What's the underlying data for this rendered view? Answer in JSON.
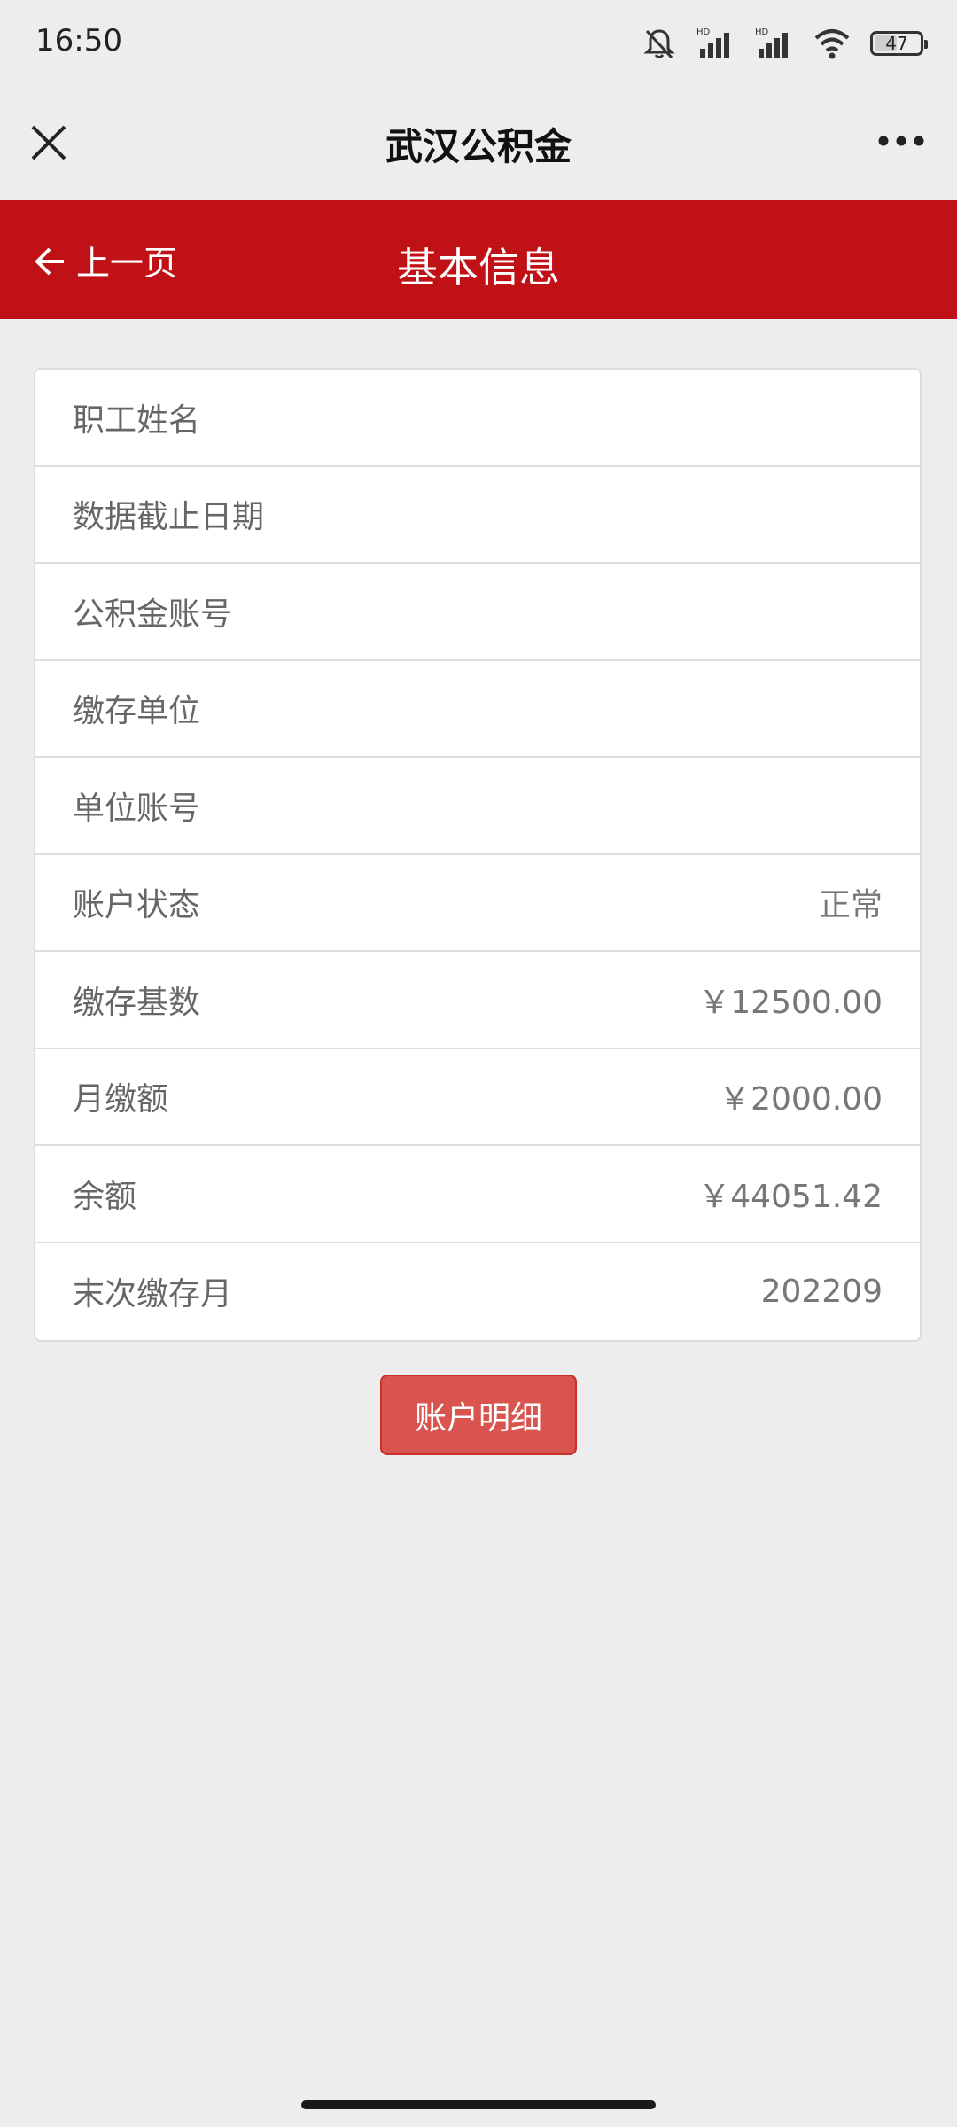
{
  "status_bar": {
    "time": "16:50",
    "battery": "47",
    "battery_level_percent": 47,
    "icons": [
      "bell-off-icon",
      "signal-hd-icon",
      "signal-hd-icon",
      "wifi-icon",
      "battery-icon"
    ]
  },
  "title_bar": {
    "title": "武汉公积金",
    "close_icon": "close-icon",
    "more_icon": "more-icon"
  },
  "header": {
    "back_label": "上一页",
    "page_title": "基本信息",
    "accent_color": "#c01116"
  },
  "info_rows": [
    {
      "label": "职工姓名",
      "value": ""
    },
    {
      "label": "数据截止日期",
      "value": ""
    },
    {
      "label": "公积金账号",
      "value": ""
    },
    {
      "label": "缴存单位",
      "value": ""
    },
    {
      "label": "单位账号",
      "value": ""
    },
    {
      "label": "账户状态",
      "value": "正常"
    },
    {
      "label": "缴存基数",
      "value": "￥12500.00"
    },
    {
      "label": "月缴额",
      "value": "￥2000.00"
    },
    {
      "label": "余额",
      "value": "￥44051.42"
    },
    {
      "label": "末次缴存月",
      "value": "202209"
    }
  ],
  "actions": {
    "detail_button": "账户明细",
    "button_color": "#d9534f"
  }
}
